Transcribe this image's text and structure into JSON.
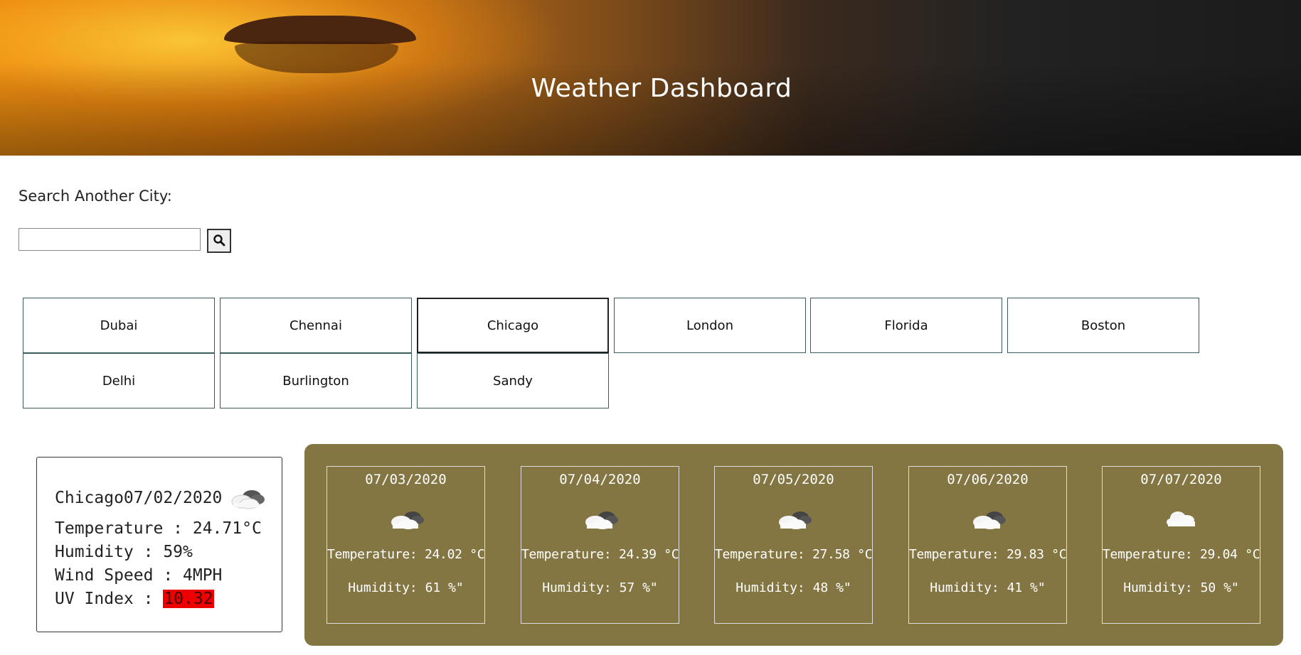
{
  "header": {
    "title": "Weather Dashboard"
  },
  "search": {
    "label": "Search Another City:",
    "value": "",
    "placeholder": "",
    "button_icon": "search-icon"
  },
  "cities": [
    "Dubai",
    "Chennai",
    "Chicago",
    "London",
    "Florida",
    "Boston",
    "Delhi",
    "Burlington",
    "Sandy"
  ],
  "selected_city": "Chicago",
  "current": {
    "heading": "Chicago07/02/2020",
    "icon": "cloudy-icon",
    "temperature": "Temperature : 24.71°C",
    "humidity": "Humidity : 59%",
    "wind": "Wind Speed : 4MPH",
    "uv_label": "UV Index : ",
    "uv_value": "10.32",
    "uv_color": "#ee0000"
  },
  "forecast_bg": "#847643",
  "forecast": [
    {
      "date": "07/03/2020",
      "icon": "partly-cloudy-icon",
      "temp": "Temperature: 24.02 °C",
      "humidity": "Humidity: 61 %\""
    },
    {
      "date": "07/04/2020",
      "icon": "partly-cloudy-icon",
      "temp": "Temperature: 24.39 °C",
      "humidity": "Humidity: 57 %\""
    },
    {
      "date": "07/05/2020",
      "icon": "partly-cloudy-icon",
      "temp": "Temperature: 27.58 °C",
      "humidity": "Humidity: 48 %\""
    },
    {
      "date": "07/06/2020",
      "icon": "partly-cloudy-icon",
      "temp": "Temperature: 29.83 °C",
      "humidity": "Humidity: 41 %\""
    },
    {
      "date": "07/07/2020",
      "icon": "cloud-icon",
      "temp": "Temperature: 29.04 °C",
      "humidity": "Humidity: 50 %\""
    }
  ]
}
